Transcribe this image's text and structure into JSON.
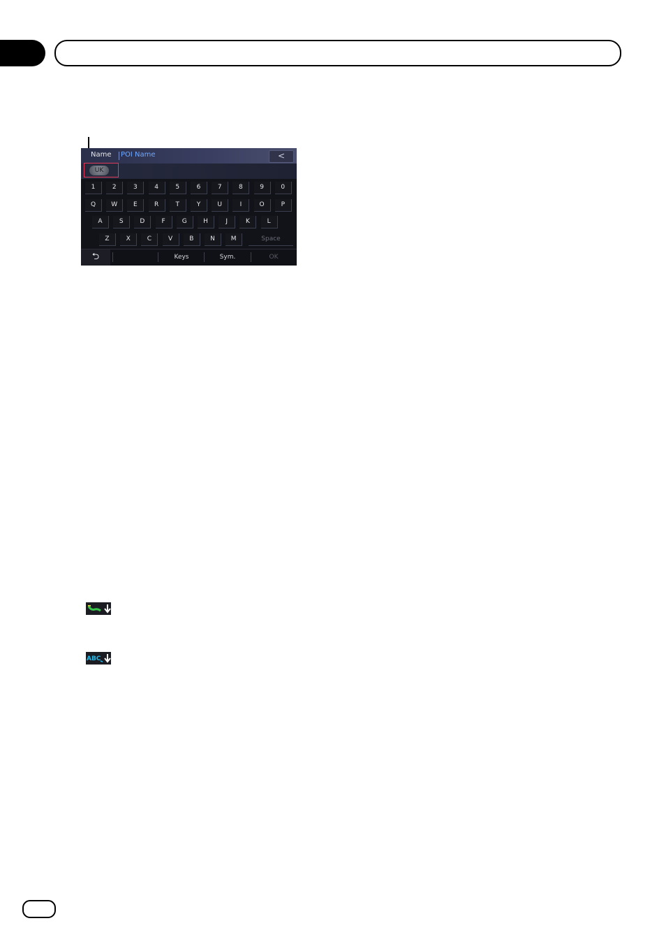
{
  "screen": {
    "title": {
      "label": "Name",
      "field": "POI Name",
      "back": "<"
    },
    "language_button": "UK",
    "keyboard": {
      "row1": [
        "1",
        "2",
        "3",
        "4",
        "5",
        "6",
        "7",
        "8",
        "9",
        "0"
      ],
      "row2": [
        "Q",
        "W",
        "E",
        "R",
        "T",
        "Y",
        "U",
        "I",
        "O",
        "P"
      ],
      "row3": [
        "A",
        "S",
        "D",
        "F",
        "G",
        "H",
        "J",
        "K",
        "L"
      ],
      "row4": [
        "Z",
        "X",
        "C",
        "V",
        "B",
        "N",
        "M"
      ],
      "space": "Space"
    },
    "bottom": {
      "undo": "⮌",
      "keys": "Keys",
      "sym": "Sym.",
      "ok": "OK"
    }
  },
  "icons": {
    "route_icon": "route-down-arrow-icon",
    "abc_icon": "abc-down-arrow-icon",
    "abc_text": "ABC"
  },
  "colors": {
    "highlight": "#e23a5a",
    "title_field": "#6ea8ff",
    "route_green": "#38c44a",
    "route_yellow": "#d8d23a",
    "abc_cyan": "#27b8e8"
  }
}
